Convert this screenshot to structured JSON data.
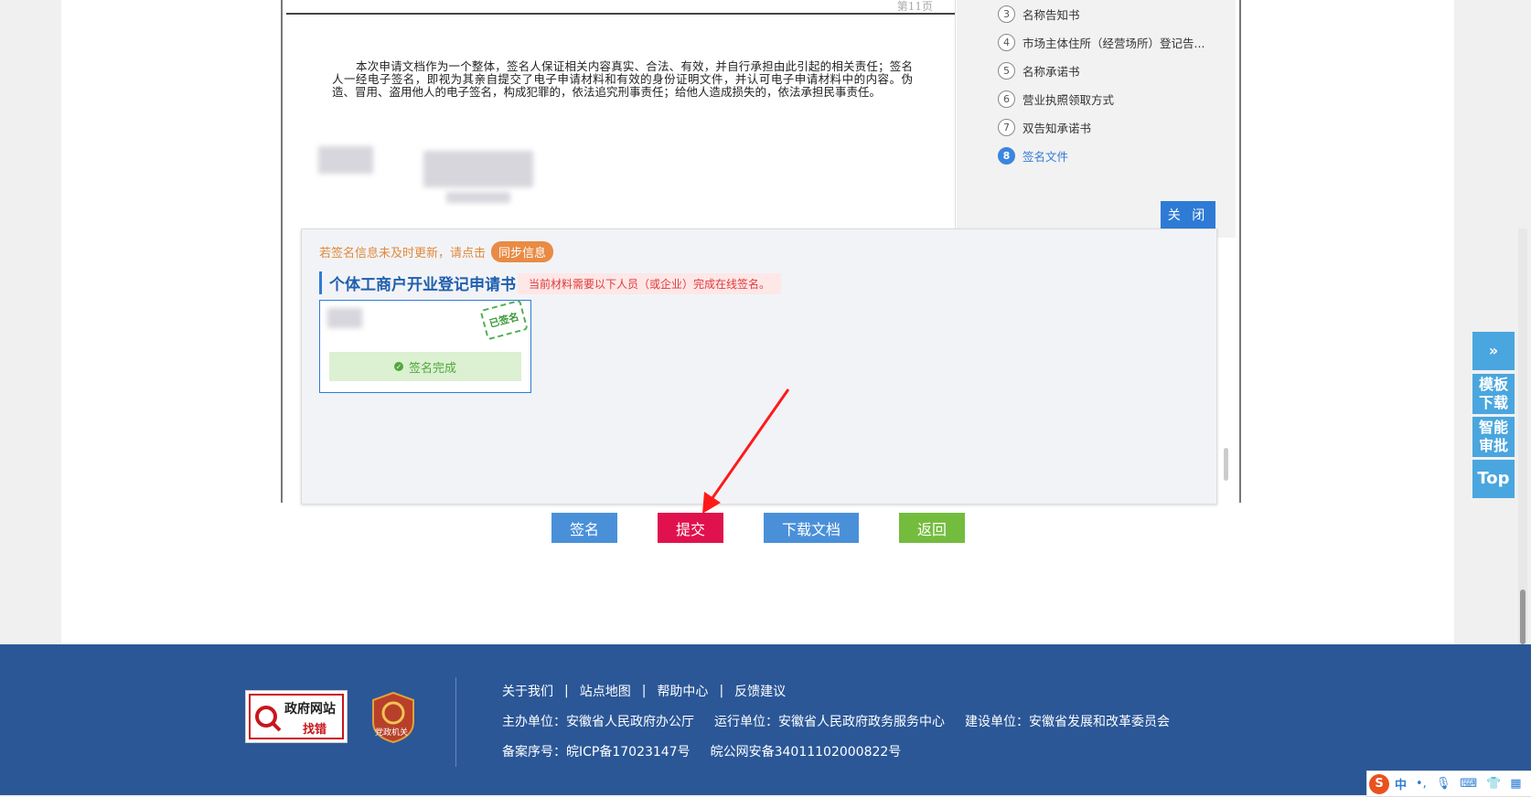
{
  "document": {
    "page_number": "第11页",
    "declaration": "本次申请文档作为一个整体，签名人保证相关内容真实、合法、有效，并自行承担由此引起的相关责任；签名人一经电子签名，即视为其亲自提交了电子申请材料和有效的身份证明文件，并认可电子申请材料中的内容。伪造、冒用、盗用他人的电子签名，构成犯罪的，依法追究刑事责任；给他人造成损失的，依法承担民事责任。"
  },
  "nav": {
    "items": [
      {
        "num": "3",
        "label": "名称告知书"
      },
      {
        "num": "4",
        "label": "市场主体住所（经营场所）登记告..."
      },
      {
        "num": "5",
        "label": "名称承诺书"
      },
      {
        "num": "6",
        "label": "营业执照领取方式"
      },
      {
        "num": "7",
        "label": "双告知承诺书"
      },
      {
        "num": "8",
        "label": "签名文件"
      }
    ],
    "close_label": "关 闭"
  },
  "signature": {
    "hint": "若签名信息未及时更新，请点击",
    "sync_label": "同步信息",
    "form_title": "个体工商户开业登记申请书",
    "warning": "当前材料需要以下人员（或企业）完成在线签名。",
    "stamp_text": "已签名",
    "status": "签名完成"
  },
  "actions": {
    "sign": "签名",
    "submit": "提交",
    "download": "下载文档",
    "back": "返回"
  },
  "colors": {
    "sign": "#4a90d9",
    "submit": "#e0124d",
    "download": "#4a90d9",
    "back": "#74bc3e"
  },
  "float_tools": {
    "expand_icon": "double-chevron-right-icon",
    "template_download": "模板下载",
    "smart_review": "智能审批",
    "top": "Top"
  },
  "footer": {
    "badge_title": "政府网站",
    "badge_sub": "找错",
    "badge2_text": "党政机关",
    "links": [
      "关于我们",
      "站点地图",
      "帮助中心",
      "反馈建议"
    ],
    "sponsor": "主办单位：安徽省人民政府办公厅",
    "operator": "运行单位：安徽省人民政府政务服务中心",
    "builder": "建设单位：安徽省发展和改革委员会",
    "icp": "备案序号：皖ICP备17023147号",
    "police": "皖公网安备34011102000822号"
  },
  "ime": {
    "logo": "S",
    "mode": "中"
  }
}
